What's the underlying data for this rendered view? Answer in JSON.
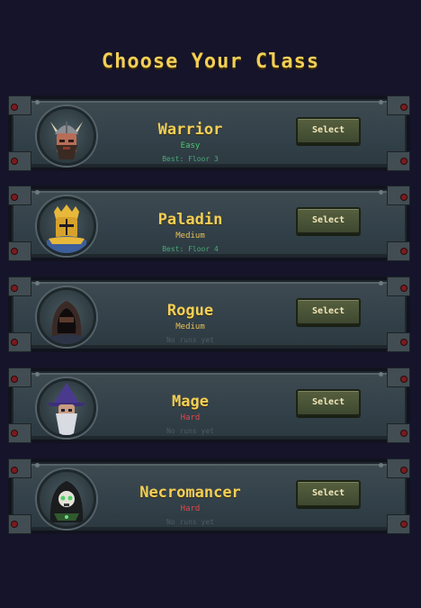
{
  "screen": {
    "title": "Choose Your Class"
  },
  "classes": [
    {
      "name": "Warrior",
      "difficulty": "Easy",
      "difficulty_color": "#4cc96b",
      "record": "Best: Floor 3",
      "record_color": "#47a978",
      "button": "Select",
      "icon": "warrior-portrait-icon"
    },
    {
      "name": "Paladin",
      "difficulty": "Medium",
      "difficulty_color": "#e8c25a",
      "record": "Best: Floor 4",
      "record_color": "#47a978",
      "button": "Select",
      "icon": "paladin-portrait-icon"
    },
    {
      "name": "Rogue",
      "difficulty": "Medium",
      "difficulty_color": "#e8c25a",
      "record": "No runs yet",
      "record_color": "#4e5b61",
      "button": "Select",
      "icon": "rogue-portrait-icon"
    },
    {
      "name": "Mage",
      "difficulty": "Hard",
      "difficulty_color": "#e0474a",
      "record": "No runs yet",
      "record_color": "#4e5b61",
      "button": "Select",
      "icon": "mage-portrait-icon"
    },
    {
      "name": "Necromancer",
      "difficulty": "Hard",
      "difficulty_color": "#e0474a",
      "record": "No runs yet",
      "record_color": "#4e5b61",
      "button": "Select",
      "icon": "necromancer-portrait-icon"
    }
  ]
}
